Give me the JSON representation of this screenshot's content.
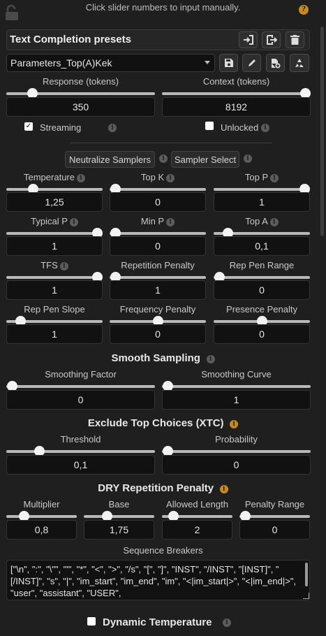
{
  "header": {
    "hint": "Click slider numbers to input manually.",
    "help_icon_glyph": "?"
  },
  "presets": {
    "title": "Text Completion presets",
    "selected": "Parameters_Top(A)Kek"
  },
  "response": {
    "label": "Response (tokens)",
    "value": "350",
    "fraction": 0.15
  },
  "context": {
    "label": "Context (tokens)",
    "value": "8192",
    "fraction": 1.0
  },
  "streaming": {
    "label": "Streaming",
    "checked": true,
    "glyph": "✓"
  },
  "unlocked": {
    "label": "Unlocked",
    "checked": false
  },
  "buttons": {
    "neutralize": "Neutralize Samplers",
    "sampler_select": "Sampler Select"
  },
  "samplers": [
    {
      "label": "Temperature",
      "info": true,
      "value": "1,25",
      "fraction": 0.25
    },
    {
      "label": "Top K",
      "info": true,
      "value": "0",
      "fraction": 0.0
    },
    {
      "label": "Top P",
      "info": true,
      "value": "1",
      "fraction": 1.0
    },
    {
      "label": "Typical P",
      "info": true,
      "value": "1",
      "fraction": 1.0
    },
    {
      "label": "Min P",
      "info": true,
      "value": "0",
      "fraction": 0.0
    },
    {
      "label": "Top A",
      "info": true,
      "value": "0,1",
      "fraction": 0.1
    },
    {
      "label": "TFS",
      "info": true,
      "value": "1",
      "fraction": 1.0
    },
    {
      "label": "Repetition Penalty",
      "info": false,
      "value": "1",
      "fraction": 0.0
    },
    {
      "label": "Rep Pen Range",
      "info": false,
      "value": "0",
      "fraction": 0.0
    },
    {
      "label": "Rep Pen Slope",
      "info": false,
      "value": "1",
      "fraction": 0.1
    },
    {
      "label": "Frequency Penalty",
      "info": false,
      "value": "0",
      "fraction": 0.5
    },
    {
      "label": "Presence Penalty",
      "info": false,
      "value": "0",
      "fraction": 0.5
    }
  ],
  "smooth": {
    "title": "Smooth Sampling",
    "factor": {
      "label": "Smoothing Factor",
      "value": "0",
      "fraction": 0.0
    },
    "curve": {
      "label": "Smoothing Curve",
      "value": "1",
      "fraction": 0.0
    }
  },
  "xtc": {
    "title": "Exclude Top Choices (XTC)",
    "threshold": {
      "label": "Threshold",
      "value": "0,1",
      "fraction": 0.2
    },
    "probability": {
      "label": "Probability",
      "value": "0",
      "fraction": 0.0
    }
  },
  "dry": {
    "title": "DRY Repetition Penalty",
    "fields": [
      {
        "label": "Multiplier",
        "value": "0,8",
        "fraction": 0.2
      },
      {
        "label": "Base",
        "value": "1,75",
        "fraction": 0.3
      },
      {
        "label": "Allowed Length",
        "value": "2",
        "fraction": 0.1
      },
      {
        "label": "Penalty Range",
        "value": "0",
        "fraction": 0.0
      }
    ],
    "seq_label": "Sequence Breakers",
    "seq_value": "[\"\\n\", \":\", \"\\\"\", \"'\", \"*\", \"<\", \">\", \"/s\", \"[\", \"]\", \"INST\", \"/INST\", \"[INST]\", \"[/INST]\", \"s\", \"|\", \"im_start\", \"im_end\", \"im\", \"<|im_start|>\", \"<|im_end|>\", \"user\", \"assistant\", \"USER\","
  },
  "dynamic_temp": {
    "title": "Dynamic Temperature",
    "checked": false
  },
  "colors": {
    "accent_info": "#c98a1a",
    "background": "#1f1f1f"
  }
}
